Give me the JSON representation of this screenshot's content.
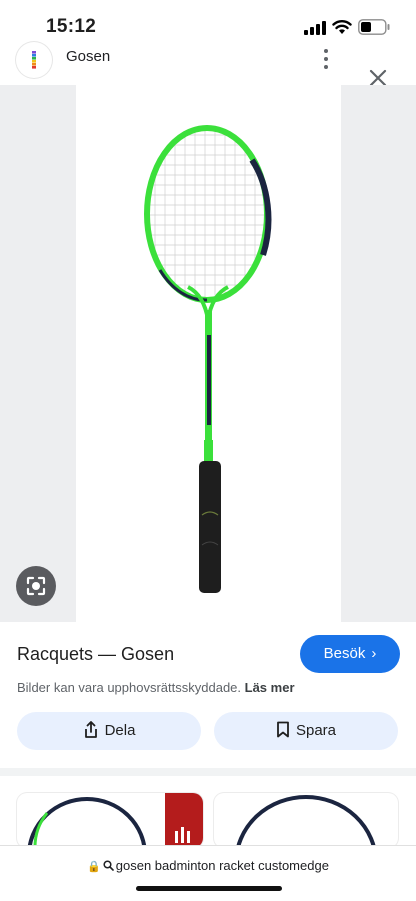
{
  "status_bar": {
    "time": "15:12"
  },
  "site": {
    "name": "Gosen"
  },
  "result": {
    "title": "Racquets — Gosen",
    "visit_label": "Besök",
    "copyright_text": "Bilder kan vara upphovsrättsskyddade.",
    "learn_more": "Läs mer"
  },
  "actions": {
    "share_label": "Dela",
    "save_label": "Spara"
  },
  "address_bar": {
    "url": "gosen badminton racket customedge"
  },
  "colors": {
    "accent": "#1a73e8",
    "pill_bg": "#e8f0fe",
    "racket_green": "#3be03b"
  },
  "icons": [
    "gosen-favicon",
    "more-vert-icon",
    "close-icon",
    "lens-icon",
    "share-icon",
    "bookmark-icon",
    "lock-icon",
    "search-icon"
  ]
}
